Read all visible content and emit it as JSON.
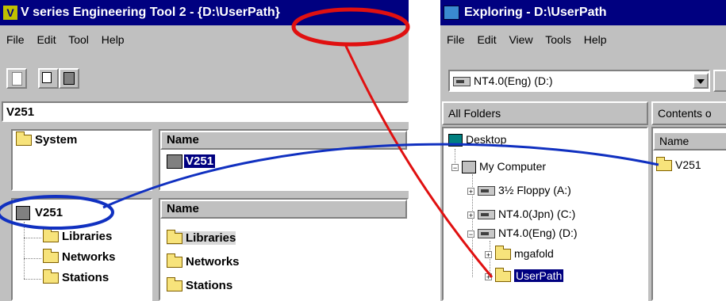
{
  "left_window": {
    "title": "V series Engineering Tool 2 - ",
    "title_path": "{D:\\UserPath}",
    "menu": [
      "File",
      "Edit",
      "Tool",
      "Help"
    ],
    "address": "V251",
    "system_label": "System",
    "name_header_1": "Name",
    "selected_item": "V251",
    "tree_root": "V251",
    "tree_children": [
      "Libraries",
      "Networks",
      "Stations"
    ],
    "name_header_2": "Name",
    "list_items": [
      "Libraries",
      "Networks",
      "Stations"
    ]
  },
  "right_window": {
    "title": "Exploring - D:\\UserPath",
    "menu": [
      "File",
      "Edit",
      "View",
      "Tools",
      "Help"
    ],
    "drive_select": "NT4.0(Eng) (D:)",
    "all_folders_label": "All Folders",
    "contents_label": "Contents o",
    "name_header": "Name",
    "content_item": "V251",
    "tree": {
      "desktop": "Desktop",
      "my_computer": "My Computer",
      "floppy": "3½ Floppy (A:)",
      "drive_c": "NT4.0(Jpn) (C:)",
      "drive_d": "NT4.0(Eng) (D:)",
      "folder_1": "mgafold",
      "folder_2": "UserPath"
    }
  },
  "colors": {
    "titlebar": "#000080",
    "window_face": "#c0c0c0",
    "highlight_red": "#e01010",
    "connector_blue": "#1030c0"
  }
}
